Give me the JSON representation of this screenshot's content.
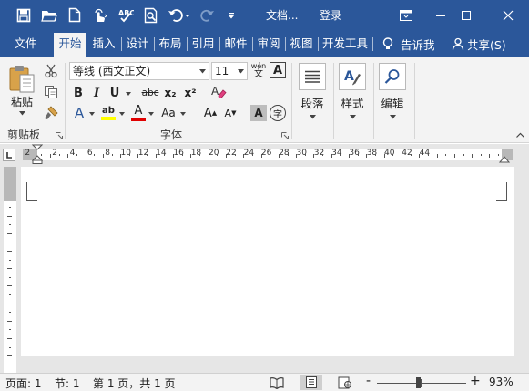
{
  "window": {
    "doc_title": "文档...",
    "signin": "登录"
  },
  "quick_access": {
    "icons": [
      "save-icon",
      "open-folder-icon",
      "new-doc-icon",
      "touch-mode-icon",
      "spelling-check-icon",
      "print-preview-icon",
      "undo-icon",
      "redo-icon",
      "customize-qat-icon"
    ]
  },
  "tabs": [
    {
      "label": "文件",
      "active": false
    },
    {
      "label": "开始",
      "active": true
    },
    {
      "label": "插入",
      "active": false
    },
    {
      "label": "设计",
      "active": false
    },
    {
      "label": "布局",
      "active": false
    },
    {
      "label": "引用",
      "active": false
    },
    {
      "label": "邮件",
      "active": false
    },
    {
      "label": "审阅",
      "active": false
    },
    {
      "label": "视图",
      "active": false
    },
    {
      "label": "开发工具",
      "active": false
    }
  ],
  "tell_me": "告诉我",
  "share": "共享(S)",
  "ribbon": {
    "clipboard": {
      "paste_label": "粘贴",
      "group_label": "剪贴板"
    },
    "font": {
      "font_name": "等线 (西文正文)",
      "font_size": "11",
      "wen_glyph": "wén",
      "wen_char": "文",
      "boxed_a": "A",
      "bold": "B",
      "italic": "I",
      "underline": "U",
      "strike": "abc",
      "subscript": "x₂",
      "superscript": "x²",
      "text_effects": "A",
      "highlight": "ab",
      "font_color": "A",
      "change_case": "Aa",
      "grow_font": "A",
      "shrink_font": "A",
      "shading_char": "A",
      "enclose_char": "字",
      "group_label": "字体"
    },
    "paragraph_label": "段落",
    "styles_label": "样式",
    "editing_label": "编辑"
  },
  "ruler": {
    "numbers": [
      "2",
      "2",
      "4",
      "6",
      "8",
      "10",
      "12",
      "14",
      "16",
      "18",
      "20",
      "22",
      "24",
      "26",
      "28",
      "30",
      "32",
      "34",
      "36",
      "38",
      "40",
      "42",
      "44"
    ]
  },
  "status": {
    "page": "页面: 1",
    "section": "节: 1",
    "page_count": "第 1 页，共 1 页",
    "zoom_minus": "-",
    "zoom_plus": "+",
    "zoom": "93%"
  },
  "colors": {
    "accent": "#2b579a",
    "highlight_yellow": "#ffff00",
    "font_color_red": "#e00000"
  }
}
